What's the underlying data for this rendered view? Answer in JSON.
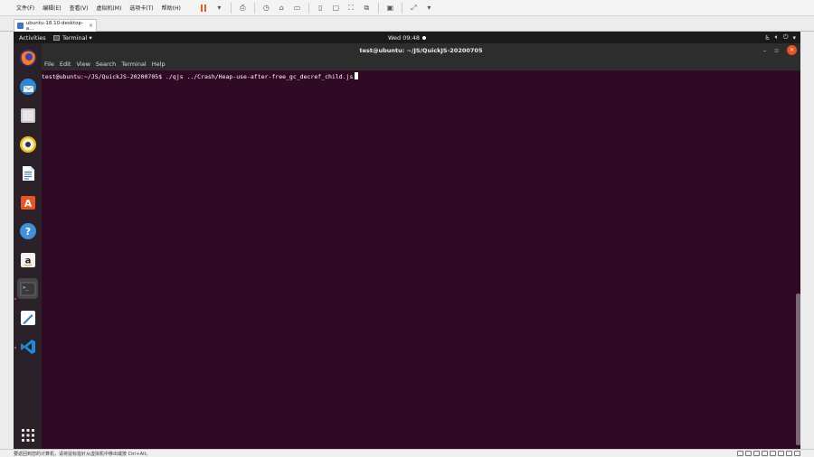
{
  "vmware": {
    "menus": [
      "文件(F)",
      "编辑(E)",
      "查看(V)",
      "虚拟机(M)",
      "选项卡(T)",
      "帮助(H)"
    ],
    "tab_title": "ubuntu-18.10-desktop-a...",
    "tab_close": "×",
    "status_text": "要返回到您的计算机，请将鼠标指针从虚拟机中移出或按 Ctrl+Alt。"
  },
  "topbar": {
    "activities": "Activities",
    "app_name": "Terminal",
    "app_caret": "▾",
    "clock": "Wed 09:48"
  },
  "dock": {
    "apps": [
      "firefox-icon",
      "thunderbird-icon",
      "files-icon",
      "rhythmbox-icon",
      "writer-icon",
      "software-icon",
      "help-icon",
      "amazon-icon",
      "terminal-icon",
      "text-editor-icon",
      "vscode-icon"
    ],
    "grid_icon": "show-applications-icon"
  },
  "terminal": {
    "title": "test@ubuntu: ~/JS/QuickJS-20200705",
    "menu": [
      "File",
      "Edit",
      "View",
      "Search",
      "Terminal",
      "Help"
    ],
    "prompt": "test@ubuntu:~/JS/QuickJS-20200705$ ./qjs ../Crash/Heap-use-after-free_gc_decref_child.js"
  },
  "colors": {
    "terminal_bg": "#300a24",
    "accent": "#e95420",
    "topbar_bg": "#1a1a1a",
    "dock_bg": "#2a2228"
  }
}
